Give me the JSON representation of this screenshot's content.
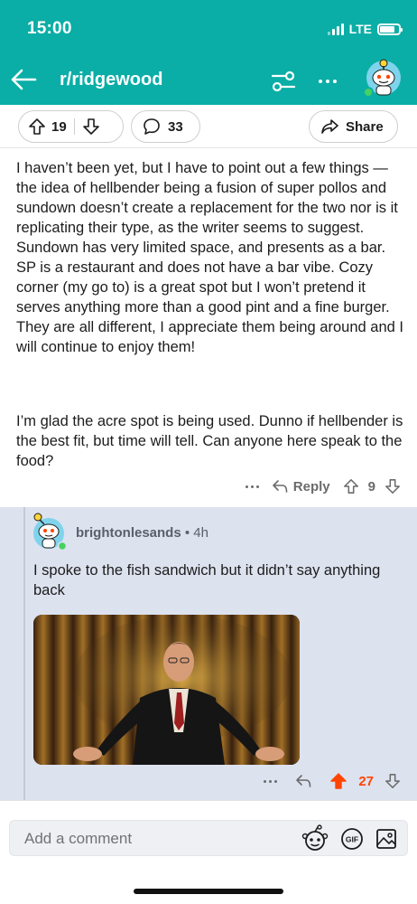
{
  "status_bar": {
    "time": "15:00",
    "network": "LTE"
  },
  "header": {
    "subreddit": "r/ridgewood",
    "icons": [
      "back-arrow-icon",
      "filter-sliders-icon",
      "more-icon",
      "snoo-avatar-icon"
    ]
  },
  "post_actions": {
    "upvotes": "19",
    "comments": "33",
    "share_label": "Share"
  },
  "comment": {
    "paragraphs": [
      "I haven’t been yet, but I have to point out a few things — the idea of hellbender being a fusion of super pollos and sundown doesn’t create a replacement for the two nor is it replicating their type, as the writer seems to suggest. Sundown has very limited space, and presents as a bar. SP is a restaurant and does not have a bar vibe. Cozy corner (my go to) is a great spot but I won’t pretend it serves anything more than a good pint and a fine burger. They are all different, I appreciate them being around and I will continue to enjoy them!",
      "I’m glad the acre spot is being used. Dunno if hellbender is the best fit, but time will tell. Can anyone here speak to the food?"
    ],
    "reply_label": "Reply",
    "votes": "9"
  },
  "reply": {
    "username": "brightonlesands",
    "separator": "•",
    "age": "4h",
    "text": "I spoke to the fish sandwich but it didn’t say anything back",
    "votes": "27",
    "upvoted": true,
    "upvote_color": "#ff4500"
  },
  "composer": {
    "placeholder": "Add a comment",
    "icons": [
      "snoo-face-icon",
      "gif-icon",
      "image-icon"
    ]
  },
  "colors": {
    "brand_teal": "#0aaea6",
    "reply_background": "#dde2ef",
    "upvote_orange": "#ff4500"
  }
}
